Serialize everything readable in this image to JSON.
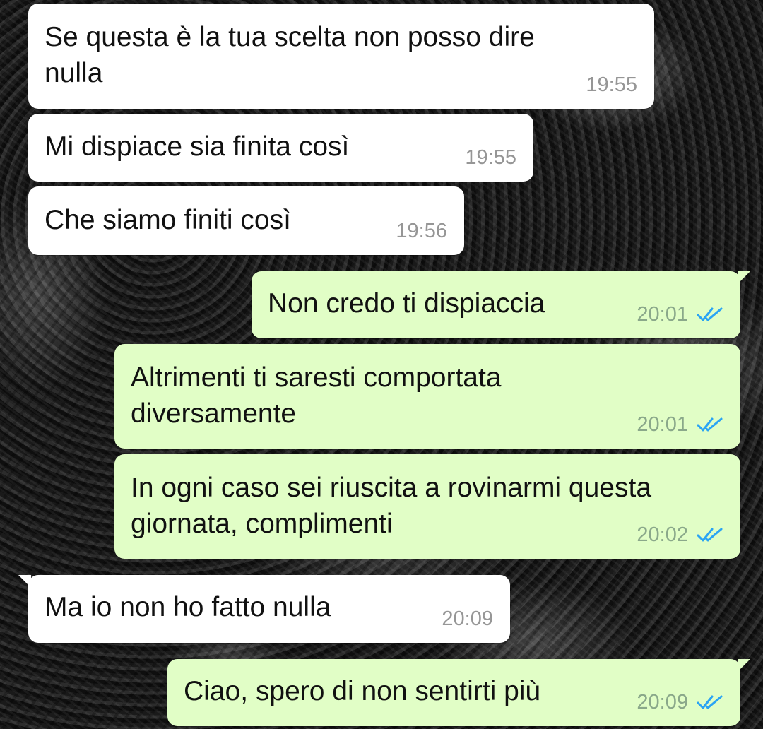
{
  "colors": {
    "incoming_bubble": "#ffffff",
    "outgoing_bubble": "#e1fec6",
    "timestamp": "#969696",
    "read_ticks": "#2aa4f4"
  },
  "messages": [
    {
      "direction": "incoming",
      "lines": [
        "Se questa è la tua scelta non posso dire",
        "nulla"
      ],
      "time": "19:55"
    },
    {
      "direction": "incoming",
      "lines": [
        "Mi dispiace sia finita così"
      ],
      "time": "19:55"
    },
    {
      "direction": "incoming",
      "lines": [
        "Che siamo finiti così"
      ],
      "time": "19:56"
    },
    {
      "direction": "outgoing",
      "lines": [
        "Non credo ti dispiaccia"
      ],
      "time": "20:01",
      "status_icon": "double-check-read-icon"
    },
    {
      "direction": "outgoing",
      "lines": [
        "Altrimenti ti saresti comportata",
        "diversamente"
      ],
      "time": "20:01",
      "status_icon": "double-check-read-icon"
    },
    {
      "direction": "outgoing",
      "lines": [
        "In ogni caso sei riuscita a rovinarmi questa",
        "giornata, complimenti"
      ],
      "time": "20:02",
      "status_icon": "double-check-read-icon"
    },
    {
      "direction": "incoming",
      "lines": [
        "Ma io non ho fatto nulla"
      ],
      "time": "20:09"
    },
    {
      "direction": "outgoing",
      "lines": [
        "Ciao, spero di non sentirti più"
      ],
      "time": "20:09",
      "status_icon": "double-check-read-icon"
    }
  ]
}
